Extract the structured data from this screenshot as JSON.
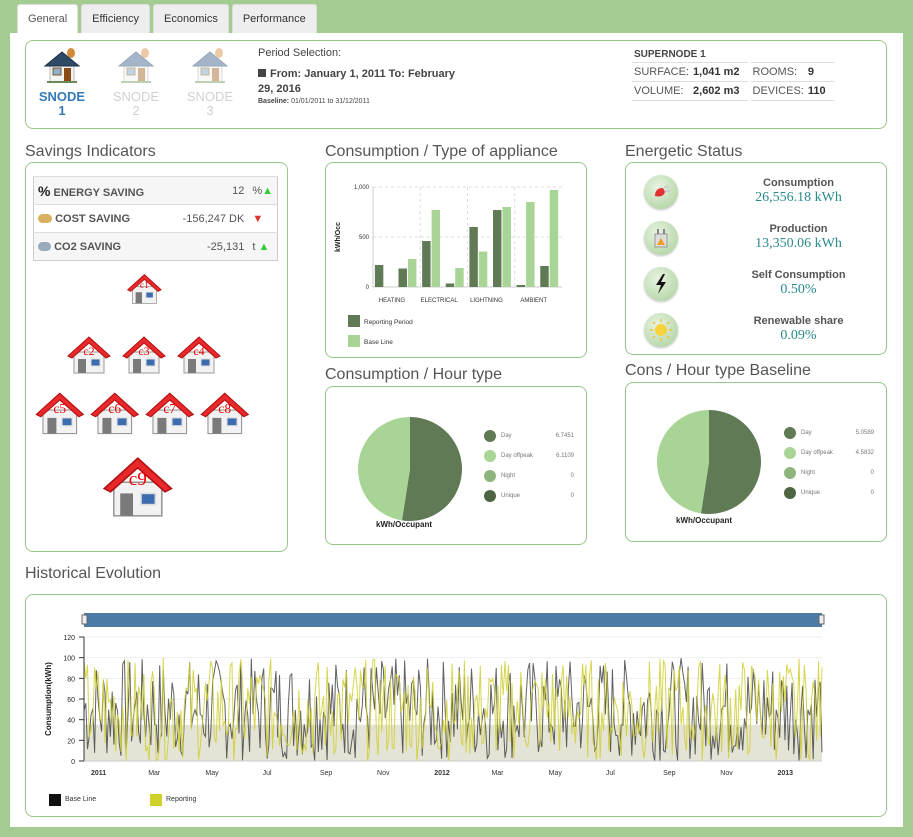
{
  "tabs": [
    {
      "label": "General",
      "active": true
    },
    {
      "label": "Efficiency",
      "active": false
    },
    {
      "label": "Economics",
      "active": false
    },
    {
      "label": "Performance",
      "active": false
    }
  ],
  "nodes": [
    {
      "label_line1": "SNODE",
      "label_line2": "1",
      "active": true
    },
    {
      "label_line1": "SNODE",
      "label_line2": "2",
      "active": false
    },
    {
      "label_line1": "SNODE",
      "label_line2": "3",
      "active": false
    }
  ],
  "period": {
    "title": "Period Selection:",
    "range": "From: January 1, 2011 To: February 29, 2016",
    "baseline_label": "Baseline:",
    "baseline_value": "01/01/2011 to 31/12/2011"
  },
  "supernode": {
    "title": "SUPERNODE 1",
    "surface_label": "SURFACE:",
    "surface_value": "1,041 m2",
    "rooms_label": "ROOMS:",
    "rooms_value": "9",
    "volume_label": "VOLUME:",
    "volume_value": "2,602 m3",
    "devices_label": "DEVICES:",
    "devices_value": "110"
  },
  "savings": {
    "title": "Savings Indicators",
    "rows": [
      {
        "icon": "percent-icon",
        "name": "ENERGY SAVING",
        "value": "12",
        "unit": "%",
        "trend": "up"
      },
      {
        "icon": "coins-icon",
        "name": "COST SAVING",
        "value": "-156,247 DK",
        "unit": "",
        "trend": "down"
      },
      {
        "icon": "cloud-icon",
        "name": "CO2 SAVING",
        "value": "-25,131",
        "unit": "t",
        "trend": "up"
      }
    ],
    "houses": [
      "c1",
      "c2",
      "c3",
      "c4",
      "c5",
      "c6",
      "c7",
      "c8",
      "c9"
    ]
  },
  "appliance": {
    "title": "Consumption / Type of appliance",
    "legend": [
      "Reporting Period",
      "Base Line"
    ]
  },
  "energetic": {
    "title": "Energetic Status",
    "items": [
      {
        "icon": "plug-icon",
        "label": "Consumption",
        "value": "26,556.18 kWh"
      },
      {
        "icon": "transformer-icon",
        "label": "Production",
        "value": "13,350.06 kWh"
      },
      {
        "icon": "lightning-icon",
        "label": "Self Consumption",
        "value": "0.50%"
      },
      {
        "icon": "sun-icon",
        "label": "Renewable share",
        "value": "0.09%"
      }
    ]
  },
  "hour_type": {
    "title": "Consumption / Hour type",
    "caption": "kWh/Occupant",
    "legend": [
      {
        "name": "Day",
        "value": "6.7451"
      },
      {
        "name": "Day offpeak",
        "value": "6.1109"
      },
      {
        "name": "Night",
        "value": "0"
      },
      {
        "name": "Unique",
        "value": "0"
      }
    ]
  },
  "hour_type_baseline": {
    "title": "Cons / Hour type Baseline",
    "caption": "kWh/Occupant",
    "legend": [
      {
        "name": "Day",
        "value": "5.0589"
      },
      {
        "name": "Day offpeak",
        "value": "4.5832"
      },
      {
        "name": "Night",
        "value": "0"
      },
      {
        "name": "Unique",
        "value": "0"
      }
    ]
  },
  "historical": {
    "title": "Historical Evolution",
    "legend": [
      "Base Line",
      "Reporting"
    ]
  },
  "colors": {
    "reporting": "#5f7a55",
    "baseline": "#a8d496",
    "night": "#8fb57f",
    "unique": "#4c6442",
    "hist_base": "#222222",
    "hist_report": "#d4d42a",
    "navigator": "#4a7aa5"
  },
  "chart_data": [
    {
      "type": "bar",
      "title": "Consumption / Type of appliance",
      "xlabel": "",
      "ylabel": "kWh/Occ",
      "ylim": [
        0,
        1000
      ],
      "yticks": [
        "0",
        "500",
        "1,000"
      ],
      "categories": [
        "HEATING",
        "",
        "ELECTRICAL",
        "",
        "LIGHTNING",
        "",
        "AMBIENT",
        ""
      ],
      "category_labels": [
        "HEATING",
        "ELECTRICAL",
        "LIGHTNING",
        "AMBIENT"
      ],
      "series": [
        {
          "name": "Reporting Period",
          "values": [
            220,
            185,
            460,
            35,
            600,
            770,
            20,
            210
          ]
        },
        {
          "name": "Base Line",
          "values": [
            5,
            280,
            770,
            190,
            355,
            800,
            850,
            970
          ]
        }
      ],
      "grid": true,
      "legend": "bottom"
    },
    {
      "type": "pie",
      "title": "Consumption / Hour type",
      "caption": "kWh/Occupant",
      "labels": [
        "Day",
        "Day offpeak",
        "Night",
        "Unique"
      ],
      "values": [
        6.7451,
        6.1109,
        0,
        0
      ],
      "legend": "right"
    },
    {
      "type": "pie",
      "title": "Cons / Hour type Baseline",
      "caption": "kWh/Occupant",
      "labels": [
        "Day",
        "Day offpeak",
        "Night",
        "Unique"
      ],
      "values": [
        5.0589,
        4.5832,
        0,
        0
      ],
      "legend": "right"
    },
    {
      "type": "line",
      "title": "Historical Evolution",
      "ylabel": "Consumption(kWh)",
      "ylim": [
        0,
        120
      ],
      "yticks": [
        0,
        20,
        40,
        60,
        80,
        100,
        120
      ],
      "xticks": [
        "2011",
        "Mar",
        "May",
        "Jul",
        "Sep",
        "Nov",
        "2012",
        "Mar",
        "May",
        "Jul",
        "Sep",
        "Nov",
        "2013"
      ],
      "xrange": [
        "2011-01-01",
        "2013-02-28"
      ],
      "series": [
        {
          "name": "Base Line",
          "description": "daily values oscillating between ~0 and ~100 kWh"
        },
        {
          "name": "Reporting",
          "description": "daily values oscillating between ~0 and ~104 kWh"
        }
      ],
      "legend": "bottom-left"
    }
  ]
}
